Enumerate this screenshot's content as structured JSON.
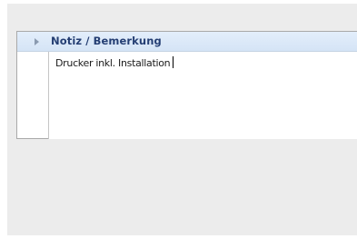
{
  "notes_panel": {
    "title": "Notiz / Bemerkung",
    "note_value": "Drucker inkl. Installation",
    "expand_icon": "triangle-right-icon"
  },
  "colors": {
    "window_background": "#ececec",
    "header_background": "#dce8f8",
    "header_title": "#243e73",
    "panel_border": "#a9a9a9"
  }
}
